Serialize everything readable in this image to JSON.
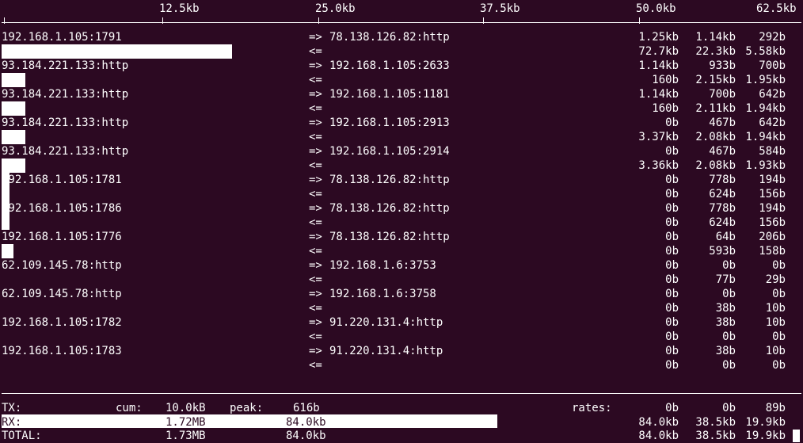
{
  "scale": [
    "12.5kb",
    "25.0kb",
    "37.5kb",
    "50.0kb",
    "62.5kb"
  ],
  "connections": [
    {
      "src": "192.168.1.105:1791",
      "dst": "78.138.126.82:http",
      "tx": [
        "1.25kb",
        "1.14kb",
        "292b"
      ],
      "rx": [
        "72.7kb",
        "22.3kb",
        "5.58kb"
      ],
      "tx_bar_fraction": 0.0,
      "rx_bar_fraction": 0.288
    },
    {
      "src": "93.184.221.133:http",
      "dst": "192.168.1.105:2633",
      "tx": [
        "1.14kb",
        "933b",
        "700b"
      ],
      "rx": [
        "160b",
        "2.15kb",
        "1.95kb"
      ],
      "tx_bar_fraction": 0.0,
      "rx_bar_fraction": 0.03
    },
    {
      "src": "93.184.221.133:http",
      "dst": "192.168.1.105:1181",
      "tx": [
        "1.14kb",
        "700b",
        "642b"
      ],
      "rx": [
        "160b",
        "2.11kb",
        "1.94kb"
      ],
      "tx_bar_fraction": 0.0,
      "rx_bar_fraction": 0.03
    },
    {
      "src": "93.184.221.133:http",
      "dst": "192.168.1.105:2913",
      "tx": [
        "0b",
        "467b",
        "642b"
      ],
      "rx": [
        "3.37kb",
        "2.08kb",
        "1.94kb"
      ],
      "tx_bar_fraction": 0.0,
      "rx_bar_fraction": 0.03
    },
    {
      "src": "93.184.221.133:http",
      "dst": "192.168.1.105:2914",
      "tx": [
        "0b",
        "467b",
        "584b"
      ],
      "rx": [
        "3.36kb",
        "2.08kb",
        "1.93kb"
      ],
      "tx_bar_fraction": 0.0,
      "rx_bar_fraction": 0.03
    },
    {
      "src": "192.168.1.105:1781",
      "dst": "78.138.126.82:http",
      "tx": [
        "0b",
        "778b",
        "194b"
      ],
      "rx": [
        "0b",
        "624b",
        "156b"
      ],
      "tx_bar_fraction": 0.01,
      "rx_bar_fraction": 0.01
    },
    {
      "src": "192.168.1.105:1786",
      "dst": "78.138.126.82:http",
      "tx": [
        "0b",
        "778b",
        "194b"
      ],
      "rx": [
        "0b",
        "624b",
        "156b"
      ],
      "tx_bar_fraction": 0.01,
      "rx_bar_fraction": 0.01
    },
    {
      "src": "192.168.1.105:1776",
      "dst": "78.138.126.82:http",
      "tx": [
        "0b",
        "64b",
        "206b"
      ],
      "rx": [
        "0b",
        "593b",
        "158b"
      ],
      "tx_bar_fraction": 0.0,
      "rx_bar_fraction": 0.015
    },
    {
      "src": "62.109.145.78:http",
      "dst": "192.168.1.6:3753",
      "tx": [
        "0b",
        "0b",
        "0b"
      ],
      "rx": [
        "0b",
        "77b",
        "29b"
      ],
      "tx_bar_fraction": 0.0,
      "rx_bar_fraction": 0.0
    },
    {
      "src": "62.109.145.78:http",
      "dst": "192.168.1.6:3758",
      "tx": [
        "0b",
        "0b",
        "0b"
      ],
      "rx": [
        "0b",
        "38b",
        "10b"
      ],
      "tx_bar_fraction": 0.0,
      "rx_bar_fraction": 0.0
    },
    {
      "src": "192.168.1.105:1782",
      "dst": "91.220.131.4:http",
      "tx": [
        "0b",
        "38b",
        "10b"
      ],
      "rx": [
        "0b",
        "0b",
        "0b"
      ],
      "tx_bar_fraction": 0.0,
      "rx_bar_fraction": 0.0
    },
    {
      "src": "192.168.1.105:1783",
      "dst": "91.220.131.4:http",
      "tx": [
        "0b",
        "38b",
        "10b"
      ],
      "rx": [
        "0b",
        "0b",
        "0b"
      ],
      "tx_bar_fraction": 0.0,
      "rx_bar_fraction": 0.0
    }
  ],
  "dir_out": "=>",
  "dir_in": "<=",
  "footer": {
    "tx": {
      "label": "TX:",
      "cum_label": "cum:",
      "cum": "10.0kB",
      "peak_label": "peak:",
      "peak": "616b",
      "rates_label": "rates:",
      "rates": [
        "0b",
        "0b",
        "89b"
      ]
    },
    "rx": {
      "label": "RX:",
      "cum": "1.72MB",
      "peak": "84.0kb",
      "rates": [
        "84.0kb",
        "38.5kb",
        "19.9kb"
      ],
      "bar_fraction": 0.62
    },
    "total": {
      "label": "TOTAL:",
      "cum": "1.73MB",
      "peak": "84.0kb",
      "rates": [
        "84.0kb",
        "38.5kb",
        "19.9kb"
      ]
    }
  }
}
